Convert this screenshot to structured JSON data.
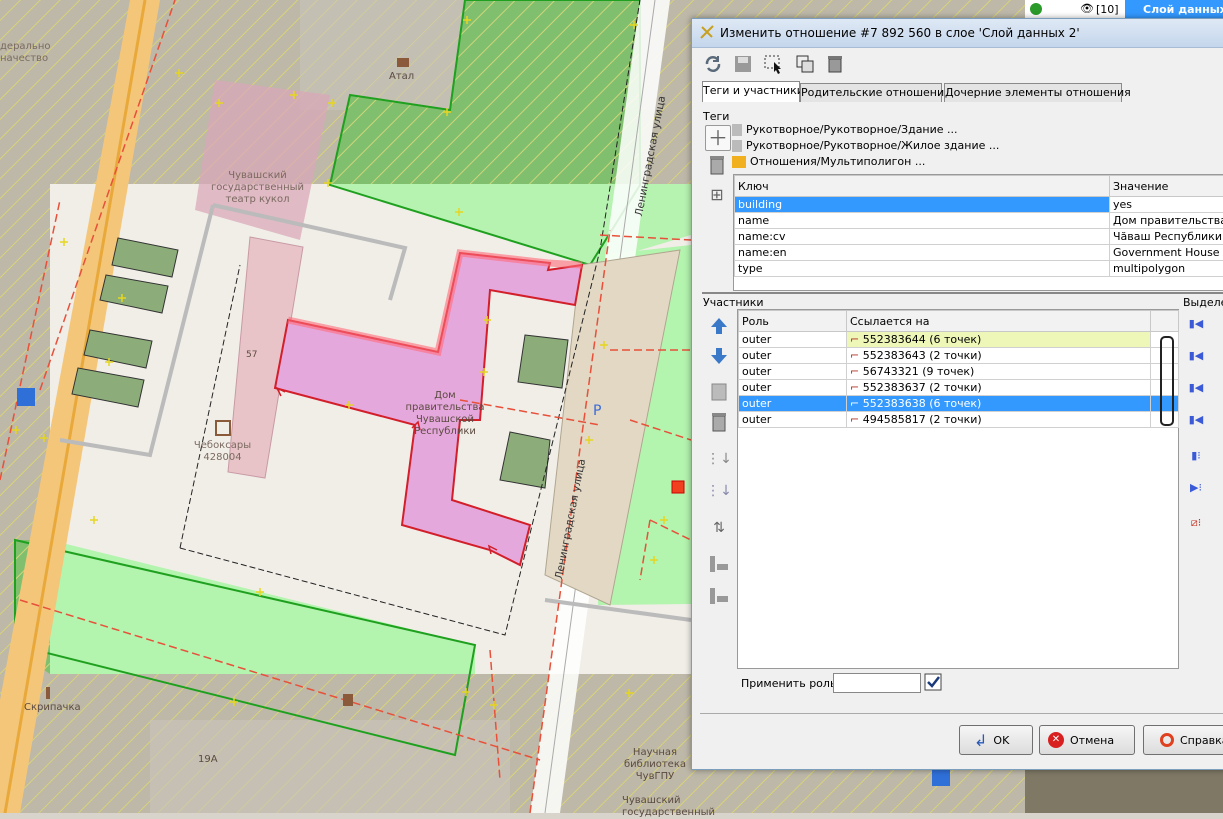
{
  "map": {
    "labels": {
      "federal": "дерально\nначество",
      "atal": "Атал",
      "theatre": "Чувашский\nгосударственный\nтеатр кукол",
      "gov": "Дом\nправительства\nЧувашской\nРеспублики",
      "post": "Чебоксары\n428004",
      "num57": "57",
      "skripachka": "Скрипачка",
      "n19a": "19А",
      "library": "Научная\nбиблиотека\nЧувГПУ",
      "chuvash_bottom": "Чувашский\nгосударственный",
      "parking": "P"
    },
    "streets": {
      "upper": "Ленинградская улица",
      "lower": "Ленинградская улица"
    }
  },
  "top_strip": {
    "count": "[10]",
    "layer": "Слой данных"
  },
  "dialog": {
    "title": "Изменить отношение #7 892 560 в слое 'Слой данных 2'",
    "tabs": [
      "Теги и участники",
      "Родительские отношения",
      "Дочерние элементы отношения"
    ],
    "tags_label": "Теги",
    "presets": [
      "Рукотворное/Рукотворное/Здание ...",
      "Рукотворное/Рукотворное/Жилое здание ...",
      "Отношения/Мультиполигон ..."
    ],
    "tag_headers": {
      "key": "Ключ",
      "value": "Значение"
    },
    "tags": [
      {
        "key": "building",
        "value": "yes"
      },
      {
        "key": "name",
        "value": "Дом правительства Ч"
      },
      {
        "key": "name:cv",
        "value": "Чăваш Республикин е"
      },
      {
        "key": "name:en",
        "value": "Government House of t"
      },
      {
        "key": "type",
        "value": "multipolygon"
      }
    ],
    "members_label": "Участники",
    "member_headers": {
      "role": "Роль",
      "ref": "Ссылается на"
    },
    "members": [
      {
        "role": "outer",
        "ref": "552383644 (6 точек)"
      },
      {
        "role": "outer",
        "ref": "552383643 (2 точки)"
      },
      {
        "role": "outer",
        "ref": "56743321 (9 точек)"
      },
      {
        "role": "outer",
        "ref": "552383637 (2 точки)"
      },
      {
        "role": "outer",
        "ref": "552383638 (6 точек)"
      },
      {
        "role": "outer",
        "ref": "494585817 (2 точки)"
      }
    ],
    "selection_label": "Выделе",
    "apply_role_label": "Применить роль:",
    "apply_role_value": "",
    "buttons": {
      "ok": "OK",
      "cancel": "Отмена",
      "help": "Справка"
    }
  }
}
